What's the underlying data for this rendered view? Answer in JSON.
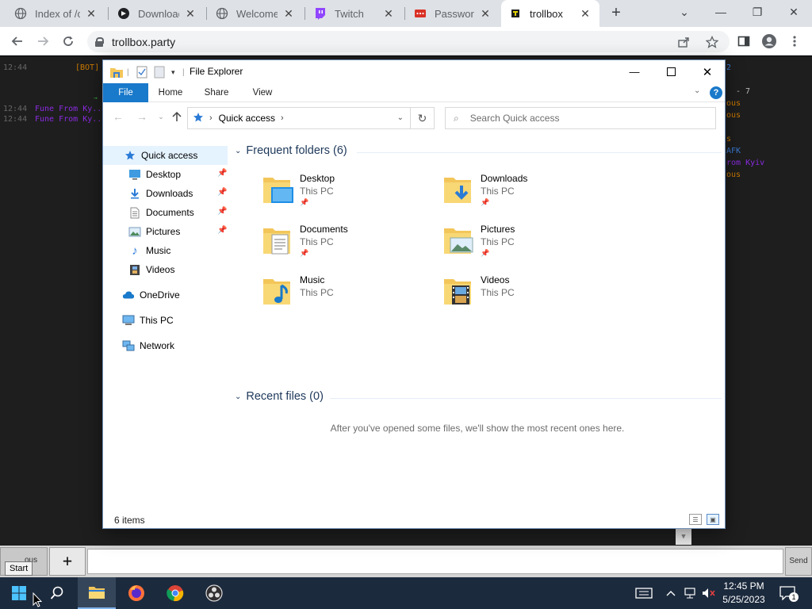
{
  "browser": {
    "tabs": [
      {
        "title": "Index of /cc",
        "icon": "globe-icon"
      },
      {
        "title": "Download",
        "icon": "download-site-icon"
      },
      {
        "title": "Welcome",
        "icon": "globe-icon"
      },
      {
        "title": "Twitch",
        "icon": "twitch-icon"
      },
      {
        "title": "Password C",
        "icon": "password-site-icon"
      },
      {
        "title": "trollbox",
        "icon": "trollbox-icon",
        "active": true
      }
    ],
    "url": "trollbox.party"
  },
  "trollbox": {
    "lines": [
      {
        "time": "12:44",
        "text": "[BOT]"
      },
      {
        "time": "12:44",
        "text": "Fune From Ky.."
      },
      {
        "time": "12:44",
        "text": "Fune From Ky.."
      }
    ],
    "right_fragments": [
      "- 7",
      "ous",
      "ous",
      "s",
      "AFK",
      "rom Kyiv",
      "ous"
    ],
    "chat_left_label": "ous",
    "plus_label": "+",
    "send_label": "Send"
  },
  "explorer": {
    "title": "File Explorer",
    "ribbon_tabs": [
      "File",
      "Home",
      "Share",
      "View"
    ],
    "help_label": "?",
    "address": {
      "location": "Quick access"
    },
    "search_placeholder": "Search Quick access",
    "sidebar": [
      {
        "label": "Quick access",
        "icon": "star-icon",
        "selected": true
      },
      {
        "label": "Desktop",
        "icon": "desktop-icon",
        "pinned": true
      },
      {
        "label": "Downloads",
        "icon": "download-arrow-icon",
        "pinned": true
      },
      {
        "label": "Documents",
        "icon": "document-icon",
        "pinned": true
      },
      {
        "label": "Pictures",
        "icon": "picture-icon",
        "pinned": true
      },
      {
        "label": "Music",
        "icon": "music-note-icon"
      },
      {
        "label": "Videos",
        "icon": "film-icon"
      },
      {
        "label": "OneDrive",
        "icon": "cloud-icon"
      },
      {
        "label": "This PC",
        "icon": "computer-icon"
      },
      {
        "label": "Network",
        "icon": "network-icon"
      }
    ],
    "frequent_header": "Frequent folders (6)",
    "folders": [
      {
        "name": "Desktop",
        "location": "This PC",
        "pinned": true,
        "icon": "desktop-folder-icon"
      },
      {
        "name": "Downloads",
        "location": "This PC",
        "pinned": true,
        "icon": "downloads-folder-icon"
      },
      {
        "name": "Documents",
        "location": "This PC",
        "pinned": true,
        "icon": "documents-folder-icon"
      },
      {
        "name": "Pictures",
        "location": "This PC",
        "pinned": true,
        "icon": "pictures-folder-icon"
      },
      {
        "name": "Music",
        "location": "This PC",
        "pinned": false,
        "icon": "music-folder-icon"
      },
      {
        "name": "Videos",
        "location": "This PC",
        "pinned": false,
        "icon": "videos-folder-icon"
      }
    ],
    "recent_header": "Recent files (0)",
    "recent_empty": "After you've opened some files, we'll show the most recent ones here.",
    "status_count": "6 items"
  },
  "taskbar": {
    "start_tooltip": "Start",
    "time": "12:45 PM",
    "date": "5/25/2023",
    "notification_count": "1"
  },
  "colors": {
    "accent": "#1979ca",
    "folder": "#f3c65a",
    "taskbar": "#1c2a3d"
  }
}
